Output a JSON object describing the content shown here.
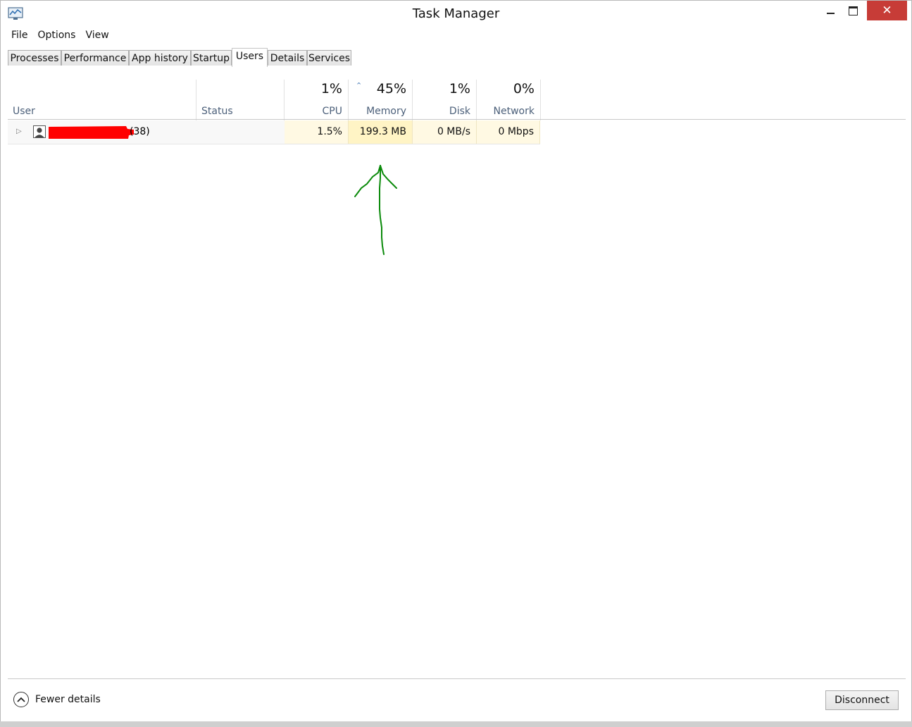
{
  "window": {
    "title": "Task Manager",
    "icon": "task-manager-icon",
    "controls": {
      "minimize": "minimize-icon",
      "maximize": "maximize-icon",
      "close": "✕"
    }
  },
  "menu": [
    "File",
    "Options",
    "View"
  ],
  "tabs": [
    {
      "label": "Processes",
      "active": false
    },
    {
      "label": "Performance",
      "active": false
    },
    {
      "label": "App history",
      "active": false
    },
    {
      "label": "Startup",
      "active": false
    },
    {
      "label": "Users",
      "active": true
    },
    {
      "label": "Details",
      "active": false
    },
    {
      "label": "Services",
      "active": false
    }
  ],
  "columns": {
    "user": {
      "label": "User"
    },
    "status": {
      "label": "Status"
    },
    "cpu": {
      "label": "CPU",
      "total": "1%"
    },
    "memory": {
      "label": "Memory",
      "total": "45%",
      "sorted": true
    },
    "disk": {
      "label": "Disk",
      "total": "1%"
    },
    "network": {
      "label": "Network",
      "total": "0%"
    }
  },
  "rows": [
    {
      "user_suffix": "(38)",
      "user_name_redacted": true,
      "redaction_color": "#ff0000",
      "status": "",
      "cpu": "1.5%",
      "memory": "199.3 MB",
      "disk": "0 MB/s",
      "network": "0 Mbps"
    }
  ],
  "annotation": {
    "type": "hand-drawn-arrow",
    "color": "#0a8a0a",
    "points_to": "Memory"
  },
  "footer": {
    "fewer_details": "Fewer details",
    "disconnect": "Disconnect"
  },
  "colors": {
    "heat_strong": "#fff4c5",
    "heat_light": "#fff9e3",
    "close_button": "#c73c37",
    "header_text": "#4c607a"
  }
}
